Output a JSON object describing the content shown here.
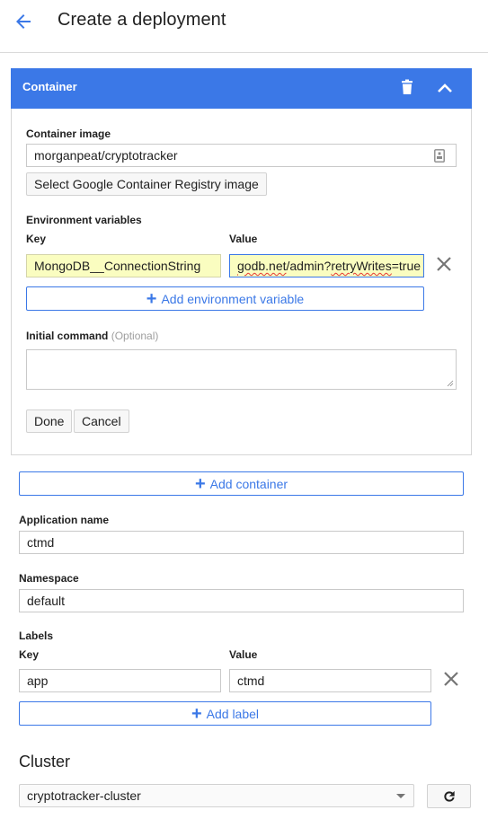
{
  "header": {
    "title": "Create a deployment",
    "back_icon": "arrow-left-icon"
  },
  "container_card": {
    "title": "Container",
    "delete_icon": "trash-icon",
    "collapse_icon": "chevron-up-icon",
    "container_image": {
      "label": "Container image",
      "value": "morganpeat/cryptotracker",
      "trailing_icon": "autofill-contact-icon"
    },
    "select_gcr_button": "Select Google Container Registry image",
    "env_vars": {
      "label": "Environment variables",
      "key_header": "Key",
      "value_header": "Value",
      "rows": [
        {
          "key": "MongoDB__ConnectionString",
          "value_prefix": "godb.net",
          "value_mid": "/admin?",
          "value_spell": "retryWrites",
          "value_suffix": "=true"
        }
      ],
      "remove_icon": "close-icon",
      "add_button": "Add environment variable"
    },
    "initial_command": {
      "label": "Initial command",
      "optional": "(Optional)",
      "value": ""
    },
    "done_button": "Done",
    "cancel_button": "Cancel"
  },
  "add_container_button": "Add container",
  "application_name": {
    "label": "Application name",
    "value": "ctmd"
  },
  "namespace": {
    "label": "Namespace",
    "value": "default"
  },
  "labels": {
    "label": "Labels",
    "key_header": "Key",
    "value_header": "Value",
    "rows": [
      {
        "key": "app",
        "value": "ctmd"
      }
    ],
    "add_button": "Add label"
  },
  "cluster": {
    "title": "Cluster",
    "selected": "cryptotracker-cluster",
    "refresh_icon": "refresh-icon"
  },
  "colors": {
    "accent": "#3b78e7",
    "autofill_bg": "#fafdc0"
  }
}
